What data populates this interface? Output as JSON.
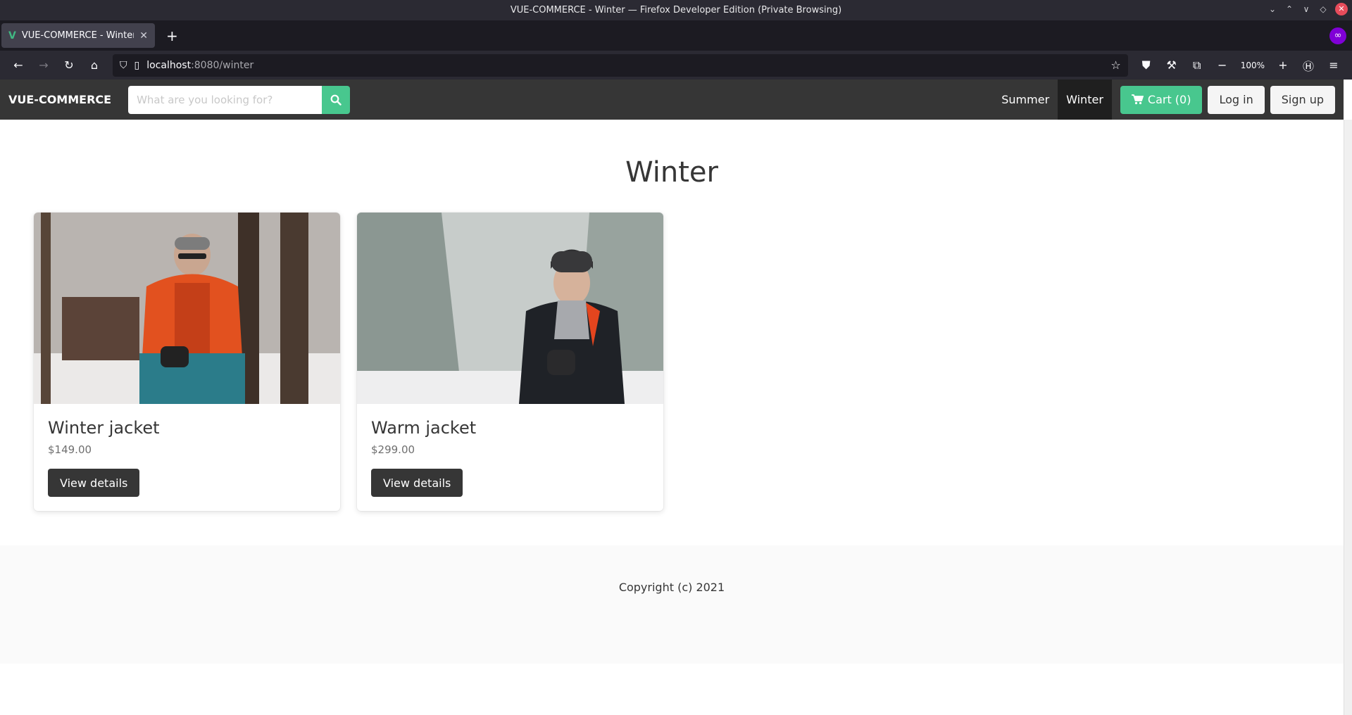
{
  "window": {
    "title": "VUE-COMMERCE - Winter — Firefox Developer Edition (Private Browsing)"
  },
  "browser": {
    "tab_title": "VUE-COMMERCE - Winter",
    "url_host": "localhost",
    "url_rest": ":8080/winter",
    "zoom": "100%"
  },
  "site": {
    "brand": "VUE-COMMERCE",
    "search_placeholder": "What are you looking for?",
    "nav": {
      "summer": "Summer",
      "winter": "Winter",
      "cart": "Cart (0)",
      "login": "Log in",
      "signup": "Sign up"
    },
    "accent_color": "#48c78e",
    "dark_color": "#363636"
  },
  "page": {
    "title": "Winter",
    "products": [
      {
        "name": "Winter jacket",
        "price": "$149.00",
        "button": "View details"
      },
      {
        "name": "Warm jacket",
        "price": "$299.00",
        "button": "View details"
      }
    ]
  },
  "footer": {
    "copyright": "Copyright (c) 2021"
  }
}
